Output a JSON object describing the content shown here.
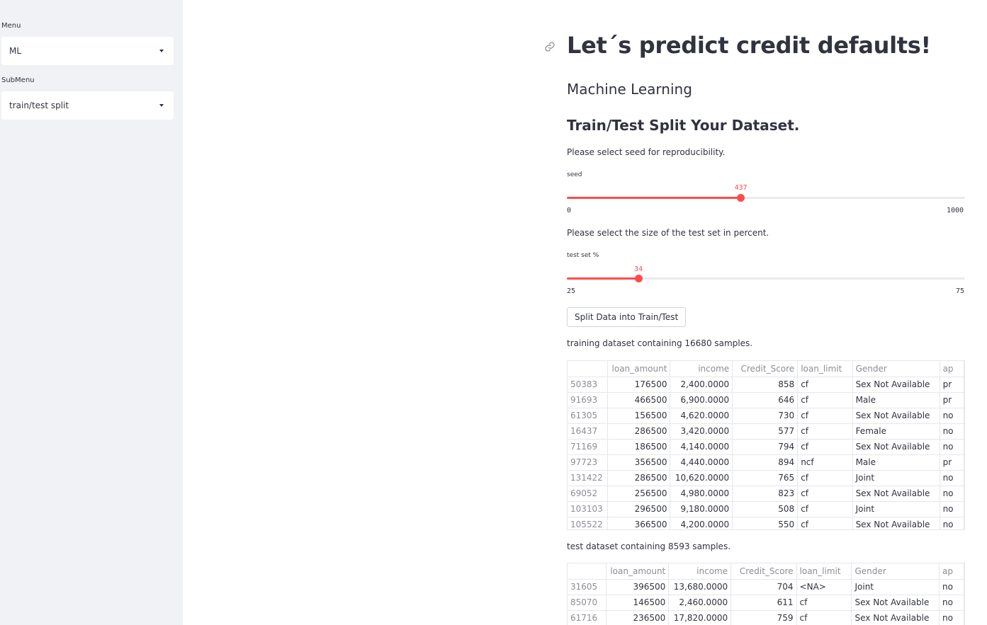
{
  "sidebar": {
    "menu_label": "Menu",
    "menu_value": "ML",
    "submenu_label": "SubMenu",
    "submenu_value": "train/test split"
  },
  "main": {
    "title": "Let´s predict credit defaults!",
    "subtitle": "Machine Learning",
    "section_title": "Train/Test Split Your Dataset.",
    "seed_prompt": "Please select seed for reproducibility.",
    "seed_slider": {
      "label": "seed",
      "value": "437",
      "min": "0",
      "max": "1000",
      "value_num": 437,
      "min_num": 0,
      "max_num": 1000
    },
    "test_prompt": "Please select the size of the test set in percent.",
    "test_slider": {
      "label": "test set %",
      "value": "34",
      "min": "25",
      "max": "75",
      "value_num": 34,
      "min_num": 25,
      "max_num": 75
    },
    "split_button": "Split Data into Train/Test",
    "train_text": "training dataset containing 16680 samples.",
    "test_text": "test dataset containing 8593 samples.",
    "columns": [
      "",
      "loan_amount",
      "income",
      "Credit_Score",
      "loan_limit",
      "Gender",
      "ap"
    ],
    "train_rows": [
      [
        "50383",
        "176500",
        "2,400.0000",
        "858",
        "cf",
        "Sex Not Available",
        "pr"
      ],
      [
        "91693",
        "466500",
        "6,900.0000",
        "646",
        "cf",
        "Male",
        "pr"
      ],
      [
        "61305",
        "156500",
        "4,620.0000",
        "730",
        "cf",
        "Sex Not Available",
        "no"
      ],
      [
        "16437",
        "286500",
        "3,420.0000",
        "577",
        "cf",
        "Female",
        "no"
      ],
      [
        "71169",
        "186500",
        "4,140.0000",
        "794",
        "cf",
        "Sex Not Available",
        "no"
      ],
      [
        "97723",
        "356500",
        "4,440.0000",
        "894",
        "ncf",
        "Male",
        "pr"
      ],
      [
        "131422",
        "286500",
        "10,620.0000",
        "765",
        "cf",
        "Joint",
        "no"
      ],
      [
        "69052",
        "256500",
        "4,980.0000",
        "823",
        "cf",
        "Sex Not Available",
        "no"
      ],
      [
        "103103",
        "296500",
        "9,180.0000",
        "508",
        "cf",
        "Joint",
        "no"
      ],
      [
        "105522",
        "366500",
        "4,200.0000",
        "550",
        "cf",
        "Sex Not Available",
        "no"
      ]
    ],
    "test_rows": [
      [
        "31605",
        "396500",
        "13,680.0000",
        "704",
        "<NA>",
        "Joint",
        "no"
      ],
      [
        "85070",
        "146500",
        "2,460.0000",
        "611",
        "cf",
        "Sex Not Available",
        "no"
      ],
      [
        "61716",
        "236500",
        "17,820.0000",
        "759",
        "cf",
        "Sex Not Available",
        "no"
      ]
    ]
  },
  "colors": {
    "accent": "#ff4b4b",
    "sidebar_bg": "#f0f2f6",
    "text": "#31333f"
  },
  "icons": {
    "anchor": "link-icon",
    "dropdown": "caret-down-icon"
  }
}
